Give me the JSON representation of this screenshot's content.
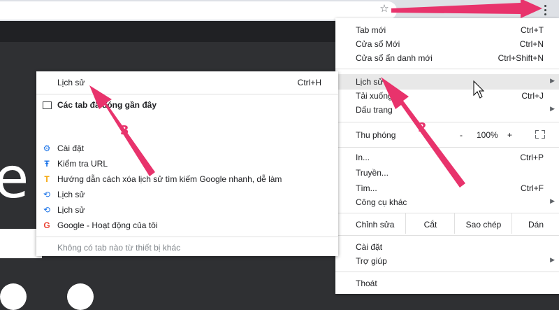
{
  "browser": {
    "star": "☆",
    "kebab": "more-vert"
  },
  "menu": {
    "items": [
      {
        "label": "Tab mới",
        "shortcut": "Ctrl+T"
      },
      {
        "label": "Cửa sổ Mới",
        "shortcut": "Ctrl+N"
      },
      {
        "label": "Cửa sổ ẩn danh mới",
        "shortcut": "Ctrl+Shift+N"
      },
      {
        "label": "Lịch sử",
        "shortcut": "",
        "submenu": true
      },
      {
        "label": "Tải xuống",
        "shortcut": "Ctrl+J"
      },
      {
        "label": "Dấu trang",
        "shortcut": "",
        "submenu": true
      },
      {
        "label": "In...",
        "shortcut": "Ctrl+P"
      },
      {
        "label": "Truyền...",
        "shortcut": ""
      },
      {
        "label": "Tìm...",
        "shortcut": "Ctrl+F"
      },
      {
        "label": "Công cụ khác",
        "shortcut": "",
        "submenu": true
      },
      {
        "label": "Cài đặt",
        "shortcut": ""
      },
      {
        "label": "Trợ giúp",
        "shortcut": "",
        "submenu": true
      },
      {
        "label": "Thoát",
        "shortcut": ""
      }
    ],
    "zoom": {
      "label": "Thu phóng",
      "minus": "-",
      "value": "100%",
      "plus": "+"
    },
    "edit": {
      "label": "Chỉnh sửa",
      "cut": "Cắt",
      "copy": "Sao chép",
      "paste": "Dán"
    }
  },
  "history": {
    "title": "Lịch sử",
    "title_shortcut": "Ctrl+H",
    "recent_header": "Các tab đã đóng gần đây",
    "entries": [
      {
        "label": "Cài đặt",
        "icon": "gear-icon"
      },
      {
        "label": "Kiểm tra URL",
        "icon": "url-check-icon"
      },
      {
        "label": "Hướng dẫn cách xóa lịch sử tìm kiếm Google nhanh, dễ làm",
        "icon": "site-favicon-icon"
      },
      {
        "label": "Lịch sử",
        "icon": "history-icon"
      },
      {
        "label": "Lịch sử",
        "icon": "history-icon"
      },
      {
        "label": "Google - Hoạt động của tôi",
        "icon": "google-icon"
      }
    ],
    "no_tabs": "Không có tab nào từ thiết bị khác"
  },
  "annotations": {
    "n1": "2",
    "n2": "3"
  },
  "colors": {
    "accent": "#e8336c",
    "highlight": "#e8e8e8",
    "gear": "#1a73e8"
  }
}
